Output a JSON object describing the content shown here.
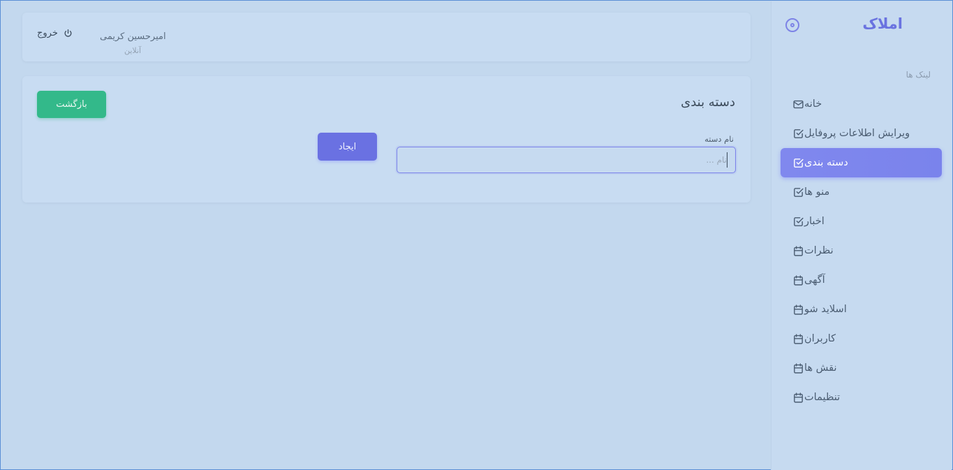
{
  "sidebar": {
    "brand": "املاک",
    "menu_header": "لینک ها",
    "items": [
      {
        "label": "خانه",
        "icon": "mail-icon",
        "active": false
      },
      {
        "label": "ویرایش اطلاعات پروفایل",
        "icon": "check-square-icon",
        "active": false
      },
      {
        "label": "دسته بندی",
        "icon": "check-square-icon",
        "active": true
      },
      {
        "label": "منو ها",
        "icon": "check-square-icon",
        "active": false
      },
      {
        "label": "اخبار",
        "icon": "check-square-icon",
        "active": false
      },
      {
        "label": "نظرات",
        "icon": "calendar-icon",
        "active": false
      },
      {
        "label": "آگهی",
        "icon": "calendar-icon",
        "active": false
      },
      {
        "label": "اسلاید شو",
        "icon": "calendar-icon",
        "active": false
      },
      {
        "label": "کاربران",
        "icon": "calendar-icon",
        "active": false
      },
      {
        "label": "نقش ها",
        "icon": "calendar-icon",
        "active": false
      },
      {
        "label": "تنظیمات",
        "icon": "calendar-icon",
        "active": false
      }
    ]
  },
  "navbar": {
    "logout_label": "خروج",
    "user_name": "امیرحسین کریمی",
    "user_status": "آنلاین"
  },
  "card": {
    "title": "دسته بندی",
    "back_label": "بازگشت",
    "field_label": "نام دسته",
    "field_placeholder": "نام ...",
    "field_value": "",
    "create_label": "ایجاد"
  },
  "colors": {
    "primary": "#6a71e2",
    "success": "#33b98a",
    "background": "#c3d8ee"
  }
}
